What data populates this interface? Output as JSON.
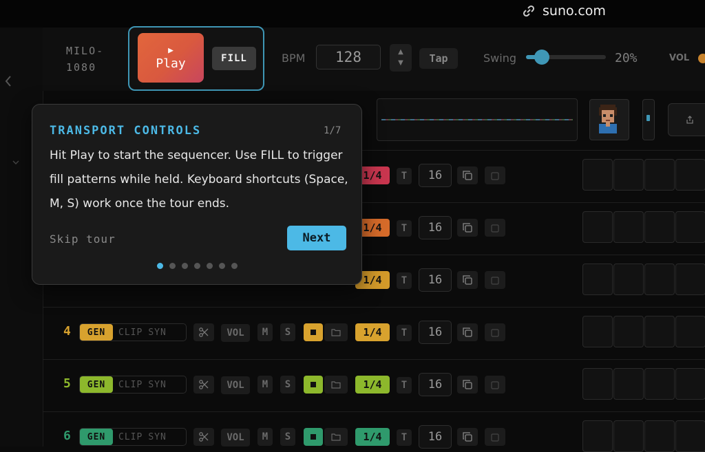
{
  "browser": {
    "url": "suno.com"
  },
  "header": {
    "model_line1": "MILO-",
    "model_line2": "1080",
    "play_icon": "play-icon",
    "play_label": "Play",
    "fill_label": "FILL",
    "bpm_label": "BPM",
    "bpm_value": "128",
    "tap_label": "Tap",
    "swing_label": "Swing",
    "swing_value": "20%",
    "swing_level": 0.2,
    "vol_label": "VOL"
  },
  "tour": {
    "title": "TRANSPORT CONTROLS",
    "step": "1/7",
    "body": "Hit Play to start the sequencer. Use FILL to trigger fill patterns while held. Keyboard shortcuts (Space, M, S) work once the tour ends.",
    "skip_label": "Skip tour",
    "next_label": "Next",
    "total_steps": 7,
    "current_step": 1
  },
  "rows": [
    {
      "number": "",
      "color": "#c9364f",
      "division": "1/4",
      "t_label": "T",
      "steps": "16"
    },
    {
      "number": "",
      "color": "#d66b2a",
      "division": "1/4",
      "t_label": "T",
      "steps": "16"
    },
    {
      "number": "",
      "color": "#d39a2a",
      "division": "1/4",
      "t_label": "T",
      "steps": "16"
    },
    {
      "number": "4",
      "color": "#d8a22e",
      "gen": "GEN",
      "clip": "CLIP",
      "syn": "SYN",
      "vol": "VOL",
      "m": "M",
      "s": "S",
      "division": "1/4",
      "t_label": "T",
      "steps": "16"
    },
    {
      "number": "5",
      "color": "#8db82c",
      "gen": "GEN",
      "clip": "CLIP",
      "syn": "SYN",
      "vol": "VOL",
      "m": "M",
      "s": "S",
      "division": "1/4",
      "t_label": "T",
      "steps": "16"
    },
    {
      "number": "6",
      "color": "#2f9a6c",
      "gen": "GEN",
      "clip": "CLIP",
      "syn": "SYN",
      "vol": "VOL",
      "m": "M",
      "s": "S",
      "division": "1/4",
      "t_label": "T",
      "steps": "16"
    }
  ]
}
